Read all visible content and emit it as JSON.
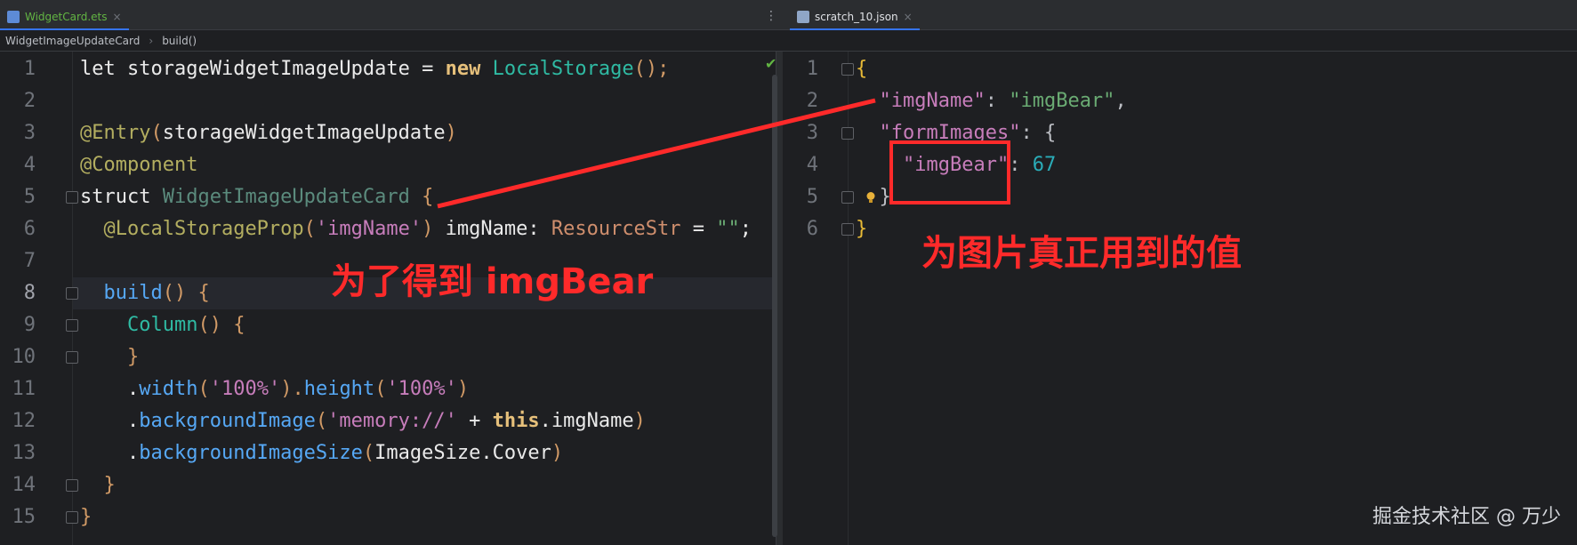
{
  "left_tab": {
    "name": "WidgetCard.ets",
    "close": "×"
  },
  "right_tab": {
    "name": "scratch_10.json",
    "close": "×"
  },
  "kebab": "⋮",
  "breadcrumb": {
    "component": "WidgetImageUpdateCard",
    "method": "build()",
    "separator": "›"
  },
  "check_mark": "✔",
  "left_code": {
    "line_numbers": [
      "1",
      "2",
      "3",
      "4",
      "5",
      "6",
      "7",
      "8",
      "9",
      "10",
      "11",
      "12",
      "13",
      "14",
      "15"
    ],
    "current_line": 8,
    "lines": [
      [
        {
          "t": "let",
          "c": "white"
        },
        {
          "t": " storageWidgetImageUpdate = ",
          "c": "white"
        },
        {
          "t": "new",
          "c": "kw2"
        },
        {
          "t": " ",
          "c": "plain"
        },
        {
          "t": "LocalStorage",
          "c": "ty"
        },
        {
          "t": "();",
          "c": "paren"
        }
      ],
      [],
      [
        {
          "t": "@Entry",
          "c": "dec"
        },
        {
          "t": "(",
          "c": "paren"
        },
        {
          "t": "storageWidgetImageUpdate",
          "c": "white"
        },
        {
          "t": ")",
          "c": "paren"
        }
      ],
      [
        {
          "t": "@Component",
          "c": "dec"
        }
      ],
      [
        {
          "t": "struct",
          "c": "white"
        },
        {
          "t": " ",
          "c": "plain"
        },
        {
          "t": "WidgetImageUpdateCard",
          "c": "ty-dim"
        },
        {
          "t": " {",
          "c": "paren"
        }
      ],
      [
        {
          "t": "  ",
          "c": "plain"
        },
        {
          "t": "@LocalStorageProp",
          "c": "dec"
        },
        {
          "t": "(",
          "c": "paren"
        },
        {
          "t": "'imgName'",
          "c": "str2"
        },
        {
          "t": ")",
          "c": "paren"
        },
        {
          "t": " imgName: ",
          "c": "white"
        },
        {
          "t": "ResourceStr",
          "c": "kw"
        },
        {
          "t": " = ",
          "c": "white"
        },
        {
          "t": "\"\"",
          "c": "str"
        },
        {
          "t": ";",
          "c": "white"
        }
      ],
      [],
      [
        {
          "t": "  ",
          "c": "plain"
        },
        {
          "t": "build",
          "c": "fn"
        },
        {
          "t": "() {",
          "c": "paren"
        }
      ],
      [
        {
          "t": "    ",
          "c": "plain"
        },
        {
          "t": "Column",
          "c": "ty"
        },
        {
          "t": "() {",
          "c": "paren"
        }
      ],
      [
        {
          "t": "    }",
          "c": "paren"
        }
      ],
      [
        {
          "t": "    .",
          "c": "white"
        },
        {
          "t": "width",
          "c": "fn"
        },
        {
          "t": "(",
          "c": "paren"
        },
        {
          "t": "'100%'",
          "c": "str2"
        },
        {
          "t": ").",
          "c": "paren"
        },
        {
          "t": "height",
          "c": "fn"
        },
        {
          "t": "(",
          "c": "paren"
        },
        {
          "t": "'100%'",
          "c": "str2"
        },
        {
          "t": ")",
          "c": "paren"
        }
      ],
      [
        {
          "t": "    .",
          "c": "white"
        },
        {
          "t": "backgroundImage",
          "c": "fn"
        },
        {
          "t": "(",
          "c": "paren"
        },
        {
          "t": "'memory://'",
          "c": "str2"
        },
        {
          "t": " + ",
          "c": "white"
        },
        {
          "t": "this",
          "c": "kw2"
        },
        {
          "t": ".imgName",
          "c": "white"
        },
        {
          "t": ")",
          "c": "paren"
        }
      ],
      [
        {
          "t": "    .",
          "c": "white"
        },
        {
          "t": "backgroundImageSize",
          "c": "fn"
        },
        {
          "t": "(",
          "c": "paren"
        },
        {
          "t": "ImageSize.Cover",
          "c": "white"
        },
        {
          "t": ")",
          "c": "paren"
        }
      ],
      [
        {
          "t": "  }",
          "c": "paren"
        }
      ],
      [
        {
          "t": "}",
          "c": "paren"
        }
      ]
    ]
  },
  "right_code": {
    "line_numbers": [
      "1",
      "2",
      "3",
      "4",
      "5",
      "6"
    ],
    "lines": [
      [
        {
          "t": "{",
          "c": "brace"
        }
      ],
      [
        {
          "t": "  ",
          "c": "plain"
        },
        {
          "t": "\"imgName\"",
          "c": "jkey"
        },
        {
          "t": ": ",
          "c": "jpun"
        },
        {
          "t": "\"imgBear\"",
          "c": "jstr"
        },
        {
          "t": ",",
          "c": "jpun"
        }
      ],
      [
        {
          "t": "  ",
          "c": "plain"
        },
        {
          "t": "\"formImages\"",
          "c": "jkey"
        },
        {
          "t": ": {",
          "c": "jpun"
        }
      ],
      [
        {
          "t": "    ",
          "c": "plain"
        },
        {
          "t": "\"imgBear\"",
          "c": "jkey"
        },
        {
          "t": ": ",
          "c": "jpun"
        },
        {
          "t": "67",
          "c": "jnum"
        }
      ],
      [
        {
          "t": "  }",
          "c": "jpun"
        }
      ],
      [
        {
          "t": "}",
          "c": "brace"
        }
      ]
    ]
  },
  "annotations": {
    "left": "为了得到 imgBear",
    "right": "为图片真正用到的值"
  },
  "watermark": "掘金技术社区 @ 万少",
  "colors": {
    "annotation": "#ff2a2a",
    "accent": "#3574f0"
  }
}
